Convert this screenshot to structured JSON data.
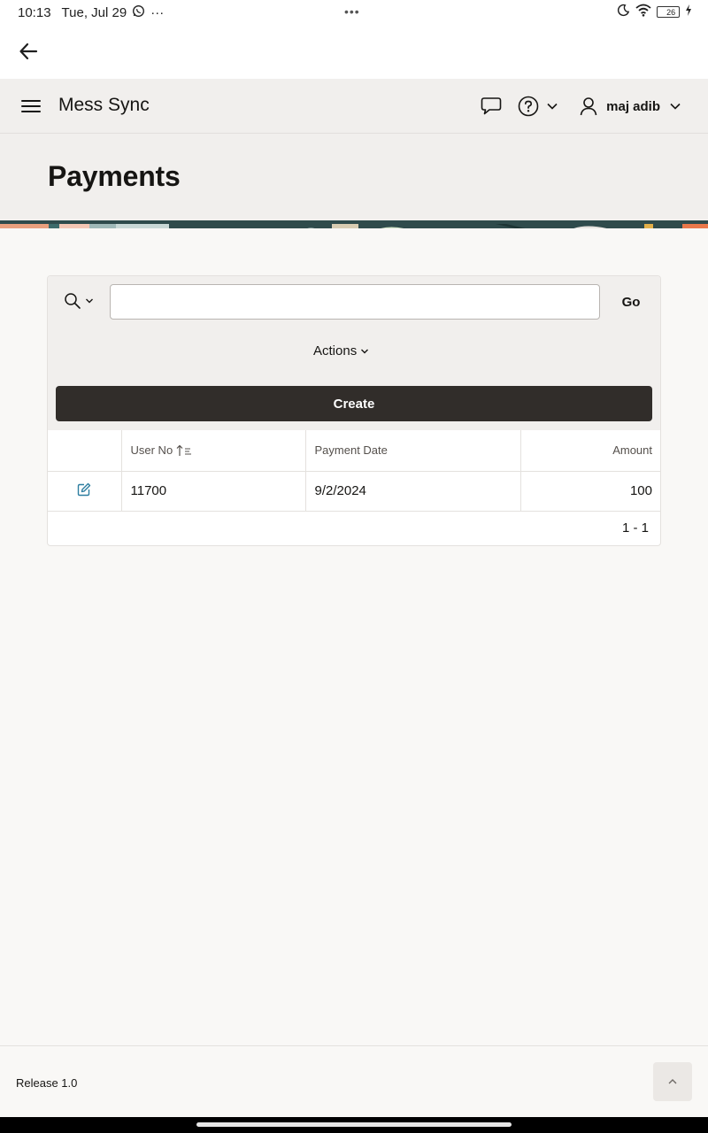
{
  "status_bar": {
    "time": "10:13",
    "date": "Tue, Jul 29",
    "overflow": "···",
    "center_dots": "•••",
    "battery_level": "26",
    "icons": [
      "whatsapp-icon",
      "moon-icon",
      "wifi-icon",
      "battery-icon",
      "charging-icon"
    ]
  },
  "app_bar": {
    "back_icon": "arrow-left-icon"
  },
  "header": {
    "app_name": "Mess Sync",
    "user_name": "maj adib",
    "icons": [
      "menu-icon",
      "feedback-icon",
      "help-icon",
      "chevron-down-icon",
      "user-icon"
    ]
  },
  "page": {
    "title": "Payments"
  },
  "report": {
    "search_placeholder": "",
    "go_label": "Go",
    "actions_label": "Actions",
    "create_label": "Create",
    "columns": [
      "User No",
      "Payment Date",
      "Amount"
    ],
    "rows": [
      {
        "user_no": "11700",
        "payment_date": "9/2/2024",
        "amount": "100"
      }
    ],
    "pagination": "1 - 1"
  },
  "footer": {
    "release": "Release 1.0"
  },
  "colors": {
    "accent_edit": "#2d7ea0",
    "create_button": "#312d2a",
    "header_bg": "#f1efed",
    "page_bg": "#f9f8f6"
  }
}
